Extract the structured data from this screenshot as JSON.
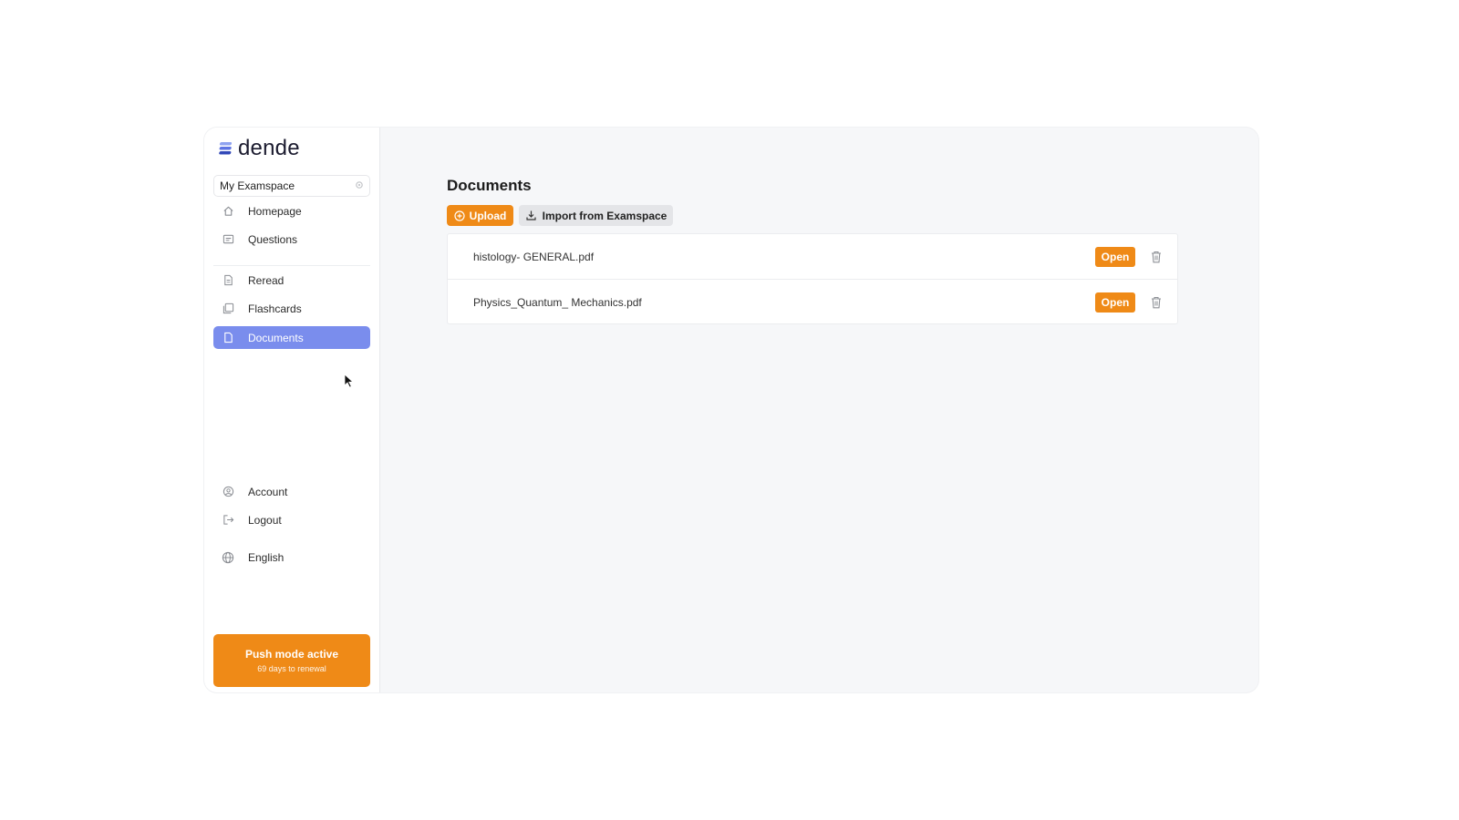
{
  "brand": {
    "name": "dende",
    "accent": "#ef8a17",
    "nav_active": "#7a8ded"
  },
  "workspace": {
    "label": "My Examspace",
    "icon": "gear-icon"
  },
  "nav": {
    "primary": [
      {
        "label": "Homepage",
        "icon": "home-icon"
      },
      {
        "label": "Questions",
        "icon": "questions-icon"
      }
    ],
    "study": [
      {
        "label": "Reread",
        "icon": "document-icon"
      },
      {
        "label": "Flashcards",
        "icon": "flashcards-icon"
      },
      {
        "label": "Documents",
        "icon": "file-icon",
        "active": true
      }
    ],
    "bottom": [
      {
        "label": "Account",
        "icon": "user-circle-icon"
      },
      {
        "label": "Logout",
        "icon": "logout-icon"
      },
      {
        "label": "English",
        "icon": "globe-icon"
      }
    ]
  },
  "push_mode": {
    "title": "Push mode active",
    "subtitle": "69 days to renewal"
  },
  "main": {
    "title": "Documents",
    "upload_label": "Upload",
    "import_label": "Import from Examspace",
    "documents": [
      {
        "name": "histology- GENERAL.pdf",
        "open_label": "Open"
      },
      {
        "name": "Physics_Quantum_ Mechanics.pdf",
        "open_label": "Open"
      }
    ]
  }
}
